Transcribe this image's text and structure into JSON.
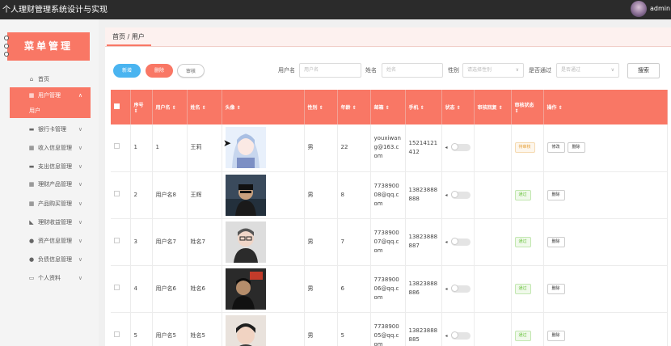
{
  "app": {
    "title": "个人理财管理系统设计与实现",
    "user": "admin"
  },
  "sidebar": {
    "header": "菜单管理",
    "items": [
      {
        "label": "首页",
        "icon": "home-icon",
        "glyph": "⌂",
        "chevron": ""
      },
      {
        "label": "用户管理",
        "icon": "grid-icon",
        "glyph": "▦",
        "chevron": "∧"
      },
      {
        "label": "用户",
        "icon": "",
        "glyph": "",
        "chevron": ""
      },
      {
        "label": "银行卡管理",
        "icon": "card-icon",
        "glyph": "▬",
        "chevron": "∨"
      },
      {
        "label": "收入信息管理",
        "icon": "grid-icon",
        "glyph": "▦",
        "chevron": "∨"
      },
      {
        "label": "支出信息管理",
        "icon": "card-icon",
        "glyph": "▬",
        "chevron": "∨"
      },
      {
        "label": "理财产品管理",
        "icon": "grid-icon",
        "glyph": "▦",
        "chevron": "∨"
      },
      {
        "label": "产品购买管理",
        "icon": "grid-icon",
        "glyph": "▦",
        "chevron": "∨"
      },
      {
        "label": "理财收益管理",
        "icon": "chart-icon",
        "glyph": "◣",
        "chevron": "∨"
      },
      {
        "label": "资产信息管理",
        "icon": "user-icon",
        "glyph": "●",
        "chevron": "∨"
      },
      {
        "label": "负债信息管理",
        "icon": "user-icon",
        "glyph": "●",
        "chevron": "∨"
      },
      {
        "label": "个人资料",
        "icon": "calendar-icon",
        "glyph": "▭",
        "chevron": "∨"
      }
    ]
  },
  "breadcrumb": "首页 / 用户",
  "toolbar": {
    "add": "新增",
    "delete": "删除",
    "review": "审核"
  },
  "filters": {
    "username_label": "用户名",
    "username_placeholder": "用户名",
    "name_label": "姓名",
    "name_placeholder": "姓名",
    "gender_label": "性别",
    "gender_placeholder": "请选择性别",
    "approved_label": "是否通过",
    "approved_placeholder": "是否通过",
    "search": "搜索"
  },
  "table": {
    "columns": [
      "序号",
      "用户名",
      "姓名",
      "头像",
      "性别",
      "年龄",
      "邮箱",
      "手机",
      "状态",
      "审核回复",
      "审核状态",
      "操作"
    ],
    "sort_glyph": "⇕",
    "rows": [
      {
        "no": "1",
        "username": "1",
        "name": "王莉",
        "gender": "男",
        "age": "22",
        "email": "youxiwang@163.com",
        "phone": "15214121412",
        "review_status": "待审核",
        "actions": [
          "修改",
          "删除"
        ]
      },
      {
        "no": "2",
        "username": "用户名8",
        "name": "王辉",
        "gender": "男",
        "age": "8",
        "email": "773890008@qq.com",
        "phone": "13823888888",
        "review_status": "通过",
        "actions": [
          "删除"
        ]
      },
      {
        "no": "3",
        "username": "用户名7",
        "name": "姓名7",
        "gender": "男",
        "age": "7",
        "email": "773890007@qq.com",
        "phone": "13823888887",
        "review_status": "通过",
        "actions": [
          "删除"
        ]
      },
      {
        "no": "4",
        "username": "用户名6",
        "name": "姓名6",
        "gender": "男",
        "age": "6",
        "email": "773890006@qq.com",
        "phone": "13823888886",
        "review_status": "通过",
        "actions": [
          "删除"
        ]
      },
      {
        "no": "5",
        "username": "用户名5",
        "name": "姓名5",
        "gender": "男",
        "age": "5",
        "email": "773890005@qq.com",
        "phone": "13823888885",
        "review_status": "通过",
        "actions": [
          "删除"
        ]
      }
    ]
  },
  "colors": {
    "accent": "#f97765",
    "blue": "#4ab4f0",
    "topbar": "#2b2b2b"
  }
}
